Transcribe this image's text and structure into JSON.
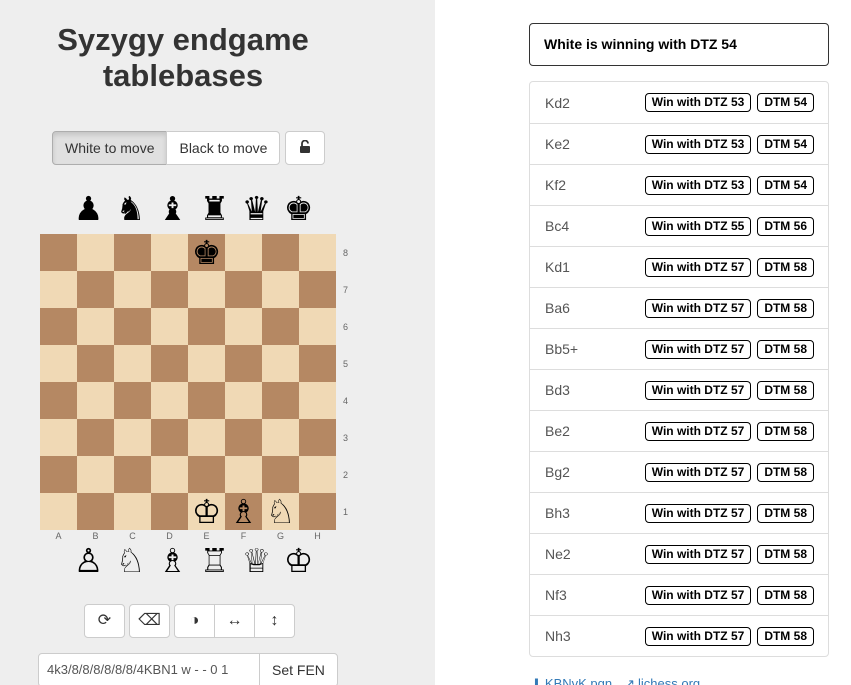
{
  "title": "Syzygy endgame tablebases",
  "side_to_move": {
    "white_label": "White to move",
    "black_label": "Black to move",
    "selected": "white"
  },
  "lock_icon": "unlock-icon",
  "spare_pieces": {
    "black": [
      "♟",
      "♞",
      "♝",
      "♜",
      "♛",
      "♚"
    ],
    "white": [
      "♙",
      "♘",
      "♗",
      "♖",
      "♕",
      "♔"
    ]
  },
  "board": {
    "ranks": [
      "8",
      "7",
      "6",
      "5",
      "4",
      "3",
      "2",
      "1"
    ],
    "files": [
      "A",
      "B",
      "C",
      "D",
      "E",
      "F",
      "G",
      "H"
    ],
    "pieces": [
      {
        "square": "e8",
        "glyph": "♚",
        "name": "black-king-icon"
      },
      {
        "square": "e1",
        "glyph": "♔",
        "name": "white-king-icon"
      },
      {
        "square": "f1",
        "glyph": "♗",
        "name": "white-bishop-icon"
      },
      {
        "square": "g1",
        "glyph": "♘",
        "name": "white-knight-icon"
      }
    ]
  },
  "tools": {
    "flip": "⟳",
    "clear": "⌫",
    "contrast": "◑",
    "mirror_h": "↔",
    "mirror_v": "↕"
  },
  "fen": {
    "value": "4k3/8/8/8/8/8/8/4KBN1 w - - 0 1",
    "button_label": "Set FEN"
  },
  "status": "White is winning with DTZ 54",
  "moves": [
    {
      "san": "Kd2",
      "dtz": "Win with DTZ 53",
      "dtm": "DTM 54"
    },
    {
      "san": "Ke2",
      "dtz": "Win with DTZ 53",
      "dtm": "DTM 54"
    },
    {
      "san": "Kf2",
      "dtz": "Win with DTZ 53",
      "dtm": "DTM 54"
    },
    {
      "san": "Bc4",
      "dtz": "Win with DTZ 55",
      "dtm": "DTM 56"
    },
    {
      "san": "Kd1",
      "dtz": "Win with DTZ 57",
      "dtm": "DTM 58"
    },
    {
      "san": "Ba6",
      "dtz": "Win with DTZ 57",
      "dtm": "DTM 58"
    },
    {
      "san": "Bb5+",
      "dtz": "Win with DTZ 57",
      "dtm": "DTM 58"
    },
    {
      "san": "Bd3",
      "dtz": "Win with DTZ 57",
      "dtm": "DTM 58"
    },
    {
      "san": "Be2",
      "dtz": "Win with DTZ 57",
      "dtm": "DTM 58"
    },
    {
      "san": "Bg2",
      "dtz": "Win with DTZ 57",
      "dtm": "DTM 58"
    },
    {
      "san": "Bh3",
      "dtz": "Win with DTZ 57",
      "dtm": "DTM 58"
    },
    {
      "san": "Ne2",
      "dtz": "Win with DTZ 57",
      "dtm": "DTM 58"
    },
    {
      "san": "Nf3",
      "dtz": "Win with DTZ 57",
      "dtm": "DTM 58"
    },
    {
      "san": "Nh3",
      "dtz": "Win with DTZ 57",
      "dtm": "DTM 58"
    }
  ],
  "links": {
    "pgn": "KBNvK.pgn",
    "lichess": "lichess.org"
  },
  "colors": {
    "light_square": "#f0d9b5",
    "dark_square": "#b58863",
    "left_bg": "#eeeeee",
    "link": "#337ab7"
  }
}
